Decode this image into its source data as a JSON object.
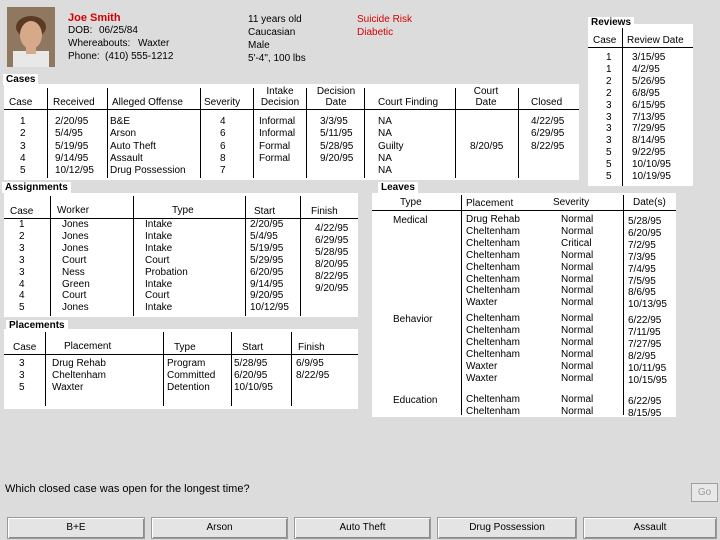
{
  "patient": {
    "name": "Joe Smith",
    "dob_label": "DOB:",
    "dob": "06/25/84",
    "whereabouts_label": "Whereabouts:",
    "whereabouts": "Waxter",
    "phone_label": "Phone:",
    "phone": "(410) 555-1212",
    "age": "11 years old",
    "race": "Caucasian",
    "sex": "Male",
    "build": "5'-4\", 100 lbs",
    "alerts": [
      "Suicide Risk",
      "Diabetic"
    ]
  },
  "reviews": {
    "title": "Reviews",
    "headers": [
      "Case",
      "Review Date"
    ],
    "rows": [
      [
        "1",
        "3/15/95"
      ],
      [
        "1",
        "4/2/95"
      ],
      [
        "2",
        "5/26/95"
      ],
      [
        "2",
        "6/8/95"
      ],
      [
        "3",
        "6/15/95"
      ],
      [
        "3",
        "7/13/95"
      ],
      [
        "3",
        "7/29/95"
      ],
      [
        "3",
        "8/14/95"
      ],
      [
        "5",
        "9/22/95"
      ],
      [
        "5",
        "10/10/95"
      ],
      [
        "5",
        "10/19/95"
      ]
    ]
  },
  "cases": {
    "title": "Cases",
    "headers": [
      "Case",
      "Received",
      "Alleged Offense",
      "Severity",
      "Intake Decision",
      "Decision Date",
      "Court Finding",
      "Court Date",
      "Closed"
    ],
    "rows": [
      [
        "1",
        "2/20/95",
        "B&E",
        "4",
        "Informal",
        "3/3/95",
        "NA",
        "",
        "4/22/95"
      ],
      [
        "2",
        "5/4/95",
        "Arson",
        "6",
        "Informal",
        "5/11/95",
        "NA",
        "",
        "6/29/95"
      ],
      [
        "3",
        "5/19/95",
        "Auto Theft",
        "6",
        "Formal",
        "5/28/95",
        "Guilty",
        "8/20/95",
        "8/22/95"
      ],
      [
        "4",
        "9/14/95",
        "Assault",
        "8",
        "Formal",
        "9/20/95",
        "NA",
        "",
        ""
      ],
      [
        "5",
        "10/12/95",
        "Drug Possession",
        "7",
        "",
        "",
        "NA",
        "",
        ""
      ]
    ]
  },
  "assignments": {
    "title": "Assignments",
    "headers": [
      "Case",
      "Worker",
      "Type",
      "Start",
      "Finish"
    ],
    "rows": [
      [
        "1",
        "Jones",
        "Intake",
        "2/20/95",
        "4/22/95"
      ],
      [
        "2",
        "Jones",
        "Intake",
        "5/4/95",
        "6/29/95"
      ],
      [
        "3",
        "Jones",
        "Intake",
        "5/19/95",
        "5/28/95"
      ],
      [
        "3",
        "Court",
        "Court",
        "5/29/95",
        "8/20/95"
      ],
      [
        "3",
        "Ness",
        "Probation",
        "6/20/95",
        "8/22/95"
      ],
      [
        "4",
        "Green",
        "Intake",
        "9/14/95",
        "9/20/95"
      ],
      [
        "4",
        "Court",
        "Court",
        "9/20/95",
        ""
      ],
      [
        "5",
        "Jones",
        "Intake",
        "10/12/95",
        ""
      ]
    ]
  },
  "placements": {
    "title": "Placements",
    "headers": [
      "Case",
      "Placement",
      "Type",
      "Start",
      "Finish"
    ],
    "rows": [
      [
        "3",
        "Drug Rehab",
        "Program",
        "5/28/95",
        "6/9/95"
      ],
      [
        "3",
        "Cheltenham",
        "Committed",
        "6/20/95",
        "8/22/95"
      ],
      [
        "5",
        "Waxter",
        "Detention",
        "10/10/95",
        ""
      ]
    ]
  },
  "leaves": {
    "title": "Leaves",
    "headers": [
      "Type",
      "Placement",
      "Severity",
      "Date(s)"
    ],
    "groups": [
      {
        "type": "Medical",
        "rows": [
          [
            "Drug Rehab",
            "Normal",
            "5/28/95"
          ],
          [
            "Cheltenham",
            "Normal",
            "6/20/95"
          ],
          [
            "Cheltenham",
            "Critical",
            "7/2/95"
          ],
          [
            "Cheltenham",
            "Normal",
            "7/3/95"
          ],
          [
            "Cheltenham",
            "Normal",
            "7/4/95"
          ],
          [
            "Cheltenham",
            "Normal",
            "7/5/95"
          ],
          [
            "Cheltenham",
            "Normal",
            "8/6/95"
          ],
          [
            "Waxter",
            "Normal",
            "10/13/95"
          ]
        ]
      },
      {
        "type": "Behavior",
        "rows": [
          [
            "Cheltenham",
            "Normal",
            "6/22/95"
          ],
          [
            "Cheltenham",
            "Normal",
            "7/11/95"
          ],
          [
            "Cheltenham",
            "Normal",
            "7/27/95"
          ],
          [
            "Cheltenham",
            "Normal",
            "8/2/95"
          ],
          [
            "Waxter",
            "Normal",
            "10/11/95"
          ],
          [
            "Waxter",
            "Normal",
            "10/15/95"
          ]
        ]
      },
      {
        "type": "Education",
        "rows": [
          [
            "Cheltenham",
            "Normal",
            "6/22/95"
          ],
          [
            "Cheltenham",
            "Normal",
            "8/15/95"
          ]
        ]
      }
    ]
  },
  "question": "Which closed case was open for the longest time?",
  "go_label": "Go",
  "answers": [
    "B+E",
    "Arson",
    "Auto Theft",
    "Drug Possession",
    "Assault"
  ],
  "colors": {
    "alert": "#d40000",
    "name": "#d40000",
    "background": "#dcdcdc"
  }
}
